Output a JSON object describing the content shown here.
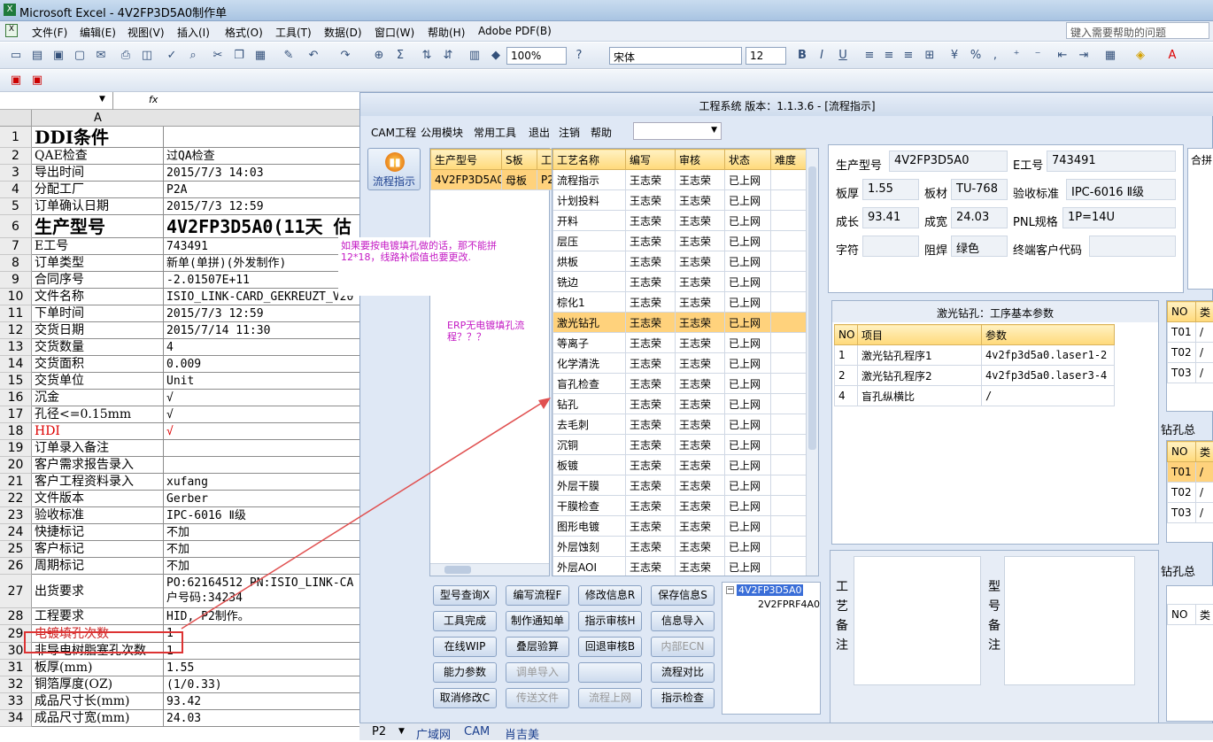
{
  "window": {
    "title": "Microsoft Excel - 4V2FP3D5A0制作单"
  },
  "menu": [
    "文件(F)",
    "编辑(E)",
    "视图(V)",
    "插入(I)",
    "格式(O)",
    "工具(T)",
    "数据(D)",
    "窗口(W)",
    "帮助(H)",
    "Adobe PDF(B)"
  ],
  "help_placeholder": "键入需要帮助的问题",
  "toolbar": {
    "zoom": "100%",
    "font": "宋体",
    "size": "12"
  },
  "formula": {
    "fx": "fx"
  },
  "sheet": {
    "col_a": "A",
    "rows": [
      {
        "n": "1",
        "a": "DDI条件",
        "b": ""
      },
      {
        "n": "2",
        "a": "QAE检查",
        "b": "过QA检查"
      },
      {
        "n": "3",
        "a": "导出时间",
        "b": "2015/7/3 14:03"
      },
      {
        "n": "4",
        "a": "分配工厂",
        "b": "P2A"
      },
      {
        "n": "5",
        "a": "订单确认日期",
        "b": "2015/7/3 12:59"
      },
      {
        "n": "6",
        "a": "生产型号",
        "b": "4V2FP3D5A0(11天 估"
      },
      {
        "n": "7",
        "a": "E工号",
        "b": "743491"
      },
      {
        "n": "8",
        "a": "订单类型",
        "b": "新单(单拼)(外发制作)"
      },
      {
        "n": "9",
        "a": "合同序号",
        "b": "-2.01507E+11"
      },
      {
        "n": "10",
        "a": "文件名称",
        "b": "ISIO_LINK-CARD_GEKREUZT_V20"
      },
      {
        "n": "11",
        "a": "下单时间",
        "b": "2015/7/3 12:59"
      },
      {
        "n": "12",
        "a": "交货日期",
        "b": "2015/7/14 11:30"
      },
      {
        "n": "13",
        "a": "交货数量",
        "b": "4"
      },
      {
        "n": "14",
        "a": "交货面积",
        "b": "0.009"
      },
      {
        "n": "15",
        "a": "交货单位",
        "b": "Unit"
      },
      {
        "n": "16",
        "a": "沉金",
        "b": "√"
      },
      {
        "n": "17",
        "a": "孔径<=0.15mm",
        "b": "√"
      },
      {
        "n": "18",
        "a": "HDI",
        "b": "√"
      },
      {
        "n": "19",
        "a": "订单录入备注",
        "b": ""
      },
      {
        "n": "20",
        "a": "客户需求报告录入",
        "b": ""
      },
      {
        "n": "21",
        "a": "客户工程资料录入",
        "b": "xufang"
      },
      {
        "n": "22",
        "a": "文件版本",
        "b": "Gerber"
      },
      {
        "n": "23",
        "a": "验收标准",
        "b": "IPC-6016 Ⅱ级"
      },
      {
        "n": "24",
        "a": "快捷标记",
        "b": "不加"
      },
      {
        "n": "25",
        "a": "客户标记",
        "b": "不加"
      },
      {
        "n": "26",
        "a": "周期标记",
        "b": "不加"
      },
      {
        "n": "27",
        "a": "出货要求",
        "b": "PO:62164512 PN:ISIO_LINK-CA"
      },
      {
        "n": "28",
        "a": "工程要求",
        "b": "HID, P2制作。"
      },
      {
        "n": "29",
        "a": "电镀填孔次数",
        "b": "1"
      },
      {
        "n": "30",
        "a": "非导电树脂塞孔次数",
        "b": "1"
      },
      {
        "n": "31",
        "a": "板厚(mm)",
        "b": "1.55"
      },
      {
        "n": "32",
        "a": "铜箔厚度(OZ)",
        "b": "(1/0.33)"
      },
      {
        "n": "33",
        "a": "成品尺寸长(mm)",
        "b": "93.42"
      },
      {
        "n": "34",
        "a": "成品尺寸宽(mm)",
        "b": "24.03"
      }
    ],
    "row27_line2": "户号码:34234"
  },
  "app": {
    "title": "工程系统  版本：1.1.3.6 - [流程指示]",
    "menu": [
      "CAM工程",
      "公用模块",
      "常用工具",
      "退出",
      "注销",
      "帮助"
    ],
    "side_button": "流程指示",
    "model_grid": {
      "headers": [
        "生产型号",
        "S板",
        "工"
      ],
      "rows": [
        [
          "4V2FP3D5A0",
          "母板",
          "P2"
        ]
      ]
    },
    "process_grid": {
      "headers": [
        "工艺名称",
        "编写",
        "审核",
        "状态",
        "难度"
      ],
      "rows": [
        [
          "流程指示",
          "王志荣",
          "王志荣",
          "已上网"
        ],
        [
          "计划投料",
          "王志荣",
          "王志荣",
          "已上网"
        ],
        [
          "开料",
          "王志荣",
          "王志荣",
          "已上网"
        ],
        [
          "层压",
          "王志荣",
          "王志荣",
          "已上网"
        ],
        [
          "烘板",
          "王志荣",
          "王志荣",
          "已上网"
        ],
        [
          "铣边",
          "王志荣",
          "王志荣",
          "已上网"
        ],
        [
          "棕化1",
          "王志荣",
          "王志荣",
          "已上网"
        ],
        [
          "激光钻孔",
          "王志荣",
          "王志荣",
          "已上网"
        ],
        [
          "等离子",
          "王志荣",
          "王志荣",
          "已上网"
        ],
        [
          "化学清洗",
          "王志荣",
          "王志荣",
          "已上网"
        ],
        [
          "盲孔检查",
          "王志荣",
          "王志荣",
          "已上网"
        ],
        [
          "钻孔",
          "王志荣",
          "王志荣",
          "已上网"
        ],
        [
          "去毛刺",
          "王志荣",
          "王志荣",
          "已上网"
        ],
        [
          "沉铜",
          "王志荣",
          "王志荣",
          "已上网"
        ],
        [
          "板镀",
          "王志荣",
          "王志荣",
          "已上网"
        ],
        [
          "外层干膜",
          "王志荣",
          "王志荣",
          "已上网"
        ],
        [
          "干膜检查",
          "王志荣",
          "王志荣",
          "已上网"
        ],
        [
          "图形电镀",
          "王志荣",
          "王志荣",
          "已上网"
        ],
        [
          "外层蚀刻",
          "王志荣",
          "王志荣",
          "已上网"
        ],
        [
          "外层AOI",
          "王志荣",
          "王志荣",
          "已上网"
        ]
      ]
    },
    "info": {
      "model_label": "生产型号",
      "model": "4V2FP3D5A0",
      "e_label": "E工号",
      "e": "743491",
      "thick_label": "板厚",
      "thick": "1.55",
      "mat_label": "板材",
      "mat": "TU-768",
      "std_label": "验收标准",
      "std": "IPC-6016 Ⅱ级",
      "len_label": "成长",
      "len": "93.41",
      "wid_label": "成宽",
      "wid": "24.03",
      "pnl_label": "PNL规格",
      "pnl": "1P=14U",
      "char_label": "字符",
      "char": "",
      "mask_label": "阻焊",
      "mask": "绿色",
      "cust_label": "终端客户代码",
      "cust": ""
    },
    "params": {
      "title": "激光钻孔：工序基本参数",
      "headers": [
        "NO",
        "项目",
        "参数"
      ],
      "rows": [
        [
          "1",
          "激光钻孔程序1",
          "4v2fp3d5a0.laser1-2"
        ],
        [
          "2",
          "激光钻孔程序2",
          "4v2fp3d5a0.laser3-4"
        ],
        [
          "4",
          "盲孔纵横比",
          "/"
        ]
      ]
    },
    "right_frag": {
      "top_label": "合拼",
      "g1": {
        "headers": [
          "NO",
          "类"
        ],
        "rows": [
          [
            "T01",
            "/"
          ],
          [
            "T02",
            "/"
          ],
          [
            "T03",
            "/"
          ]
        ]
      },
      "label2": "钻孔总",
      "g2": {
        "headers": [
          "NO",
          "类"
        ],
        "rows": [
          [
            "T01",
            "/"
          ],
          [
            "T02",
            "/"
          ],
          [
            "T03",
            "/"
          ]
        ]
      },
      "label3": "钻孔总",
      "g3": {
        "headers": [
          "NO",
          "类"
        ]
      }
    },
    "buttons": [
      [
        "型号查询X",
        "编写流程F",
        "修改信息R",
        "保存信息S"
      ],
      [
        "工具完成",
        "制作通知单",
        "指示审核H",
        "信息导入"
      ],
      [
        "在线WIP",
        "叠层验算",
        "回退审核B",
        "内部ECN"
      ],
      [
        "能力参数",
        "调单导入",
        "",
        "流程对比"
      ],
      [
        "取消修改C",
        "传送文件",
        "流程上网",
        "指示检查"
      ]
    ],
    "disabled_buttons": [
      "内部ECN",
      "调单导入",
      "传送文件",
      "流程上网",
      ""
    ],
    "tree": {
      "root": "4V2FP3D5A0",
      "child": "2V2FPRF4A0"
    },
    "craft_note_label": "工艺备注",
    "model_note_label": "型号备注",
    "bottom_tabs": [
      "P2",
      "广域网",
      "CAM",
      "肖吉美"
    ]
  },
  "annotations": {
    "note1": "如果要按电镀填孔做的话，那不能拼12*18，线路补偿值也要更改.",
    "note2": "ERP无电镀填孔流程？？？"
  },
  "colors": {
    "accent": "#ffd27c",
    "annotation": "#c419c4",
    "arrow": "#e05050",
    "header": "#ffd97a"
  }
}
